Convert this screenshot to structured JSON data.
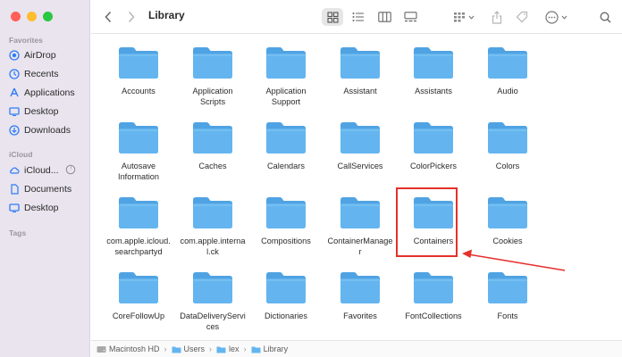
{
  "window": {
    "title": "Library"
  },
  "sidebar": {
    "favorites_header": "Favorites",
    "icloud_header": "iCloud",
    "tags_header": "Tags",
    "favorites": [
      {
        "label": "AirDrop",
        "icon": "airdrop-icon"
      },
      {
        "label": "Recents",
        "icon": "clock-icon"
      },
      {
        "label": "Applications",
        "icon": "applications-icon"
      },
      {
        "label": "Desktop",
        "icon": "desktop-icon"
      },
      {
        "label": "Downloads",
        "icon": "downloads-icon"
      }
    ],
    "icloud": [
      {
        "label": "iCloud...",
        "icon": "cloud-icon"
      },
      {
        "label": "Documents",
        "icon": "document-icon"
      },
      {
        "label": "Desktop",
        "icon": "desktop-icon"
      }
    ]
  },
  "items": [
    "Accounts",
    "Application Scripts",
    "Application Support",
    "Assistant",
    "Assistants",
    "Audio",
    "Autosave Information",
    "Caches",
    "Calendars",
    "CallServices",
    "ColorPickers",
    "Colors",
    "com.apple.icloud.searchpartyd",
    "com.apple.internal.ck",
    "Compositions",
    "ContainerManager",
    "Containers",
    "Cookies",
    "CoreFollowUp",
    "DataDeliveryServices",
    "Dictionaries",
    "Favorites",
    "FontCollections",
    "Fonts"
  ],
  "item_labels_display": [
    "Accounts",
    "Application\nScripts",
    "Application\nSupport",
    "Assistant",
    "Assistants",
    "Audio",
    "Autosave\nInformation",
    "Caches",
    "Calendars",
    "CallServices",
    "ColorPickers",
    "Colors",
    "com.apple.icloud.\nsearchpartyd",
    "com.apple.interna\nl.ck",
    "Compositions",
    "ContainerManage\nr",
    "Containers",
    "Cookies",
    "CoreFollowUp",
    "DataDeliveryServi\nces",
    "Dictionaries",
    "Favorites",
    "FontCollections",
    "Fonts"
  ],
  "highlighted_item": "Containers",
  "path": [
    "Macintosh HD",
    "Users",
    "lex",
    "Library"
  ],
  "colors": {
    "accent": "#2f7cf6",
    "folder": "#64b5ef",
    "folder_tab": "#4fa3e3",
    "highlight": "#e5302b"
  }
}
